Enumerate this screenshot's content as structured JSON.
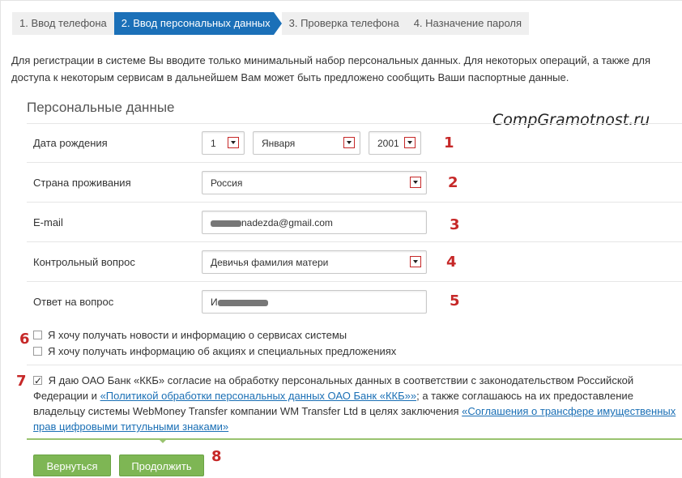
{
  "steps": [
    {
      "label": "1. Ввод телефона",
      "active": false
    },
    {
      "label": "2. Ввод персональных данных",
      "active": true
    },
    {
      "label": "3. Проверка телефона",
      "active": false
    },
    {
      "label": "4. Назначение пароля",
      "active": false
    }
  ],
  "intro": "Для регистрации в системе Вы вводите только минимальный набор персональных данных. Для некоторых операций, а также для доступа к некоторым сервисам в дальнейшем Вам может быть предложено сообщить Ваши паспортные данные.",
  "section_title": "Персональные данные",
  "watermark": "CompGramotnost.ru",
  "form": {
    "birth_date": {
      "label": "Дата рождения",
      "day": "1",
      "month": "Января",
      "year": "2001"
    },
    "country": {
      "label": "Страна проживания",
      "value": "Россия"
    },
    "email": {
      "label": "E-mail",
      "value": "nadezda@gmail.com"
    },
    "question": {
      "label": "Контрольный вопрос",
      "value": "Девичья фамилия матери"
    },
    "answer": {
      "label": "Ответ на вопрос",
      "value": "И"
    }
  },
  "checkboxes": {
    "news": {
      "label": "Я хочу получать новости и информацию о сервисах системы",
      "checked": false
    },
    "promo": {
      "label": "Я хочу получать информацию об акциях и специальных предложениях",
      "checked": false
    }
  },
  "consent": {
    "checked": true,
    "text_before": "Я даю ОАО Банк «ККБ» согласие на обработку персональных данных в соответствии с законодательством Российской Федерации и",
    "link1": "«Политикой обработки персональных данных ОАО Банк «ККБ»»",
    "text_middle": "; а также соглашаюсь на их предоставление владельцу системы WebMoney Transfer компании WM Transfer Ltd в целях заключения",
    "link2": "«Соглашения о трансфере имущественных прав цифровыми титульными знаками»"
  },
  "buttons": {
    "back": "Вернуться",
    "continue": "Продолжить"
  },
  "annotations": [
    "1",
    "2",
    "3",
    "4",
    "5",
    "6",
    "7",
    "8"
  ],
  "colors": {
    "step_active": "#1b70b8",
    "button": "#7eb654",
    "annotation": "#c62828",
    "link": "#1a6fb5"
  }
}
